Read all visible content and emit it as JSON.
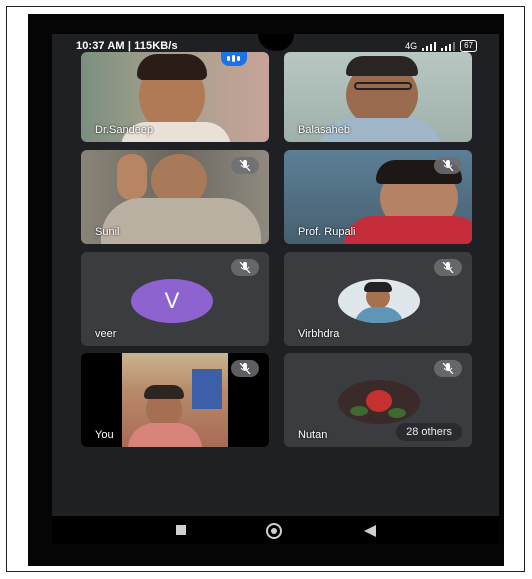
{
  "status_bar": {
    "time": "10:37 AM | 115KB/s",
    "battery": "67",
    "signal_text": "4G"
  },
  "participants": [
    {
      "name": "Dr.Sandeep",
      "muted": false,
      "speaking": true
    },
    {
      "name": "Balasaheb",
      "muted": false,
      "speaking": false
    },
    {
      "name": "Sunil",
      "muted": true,
      "speaking": false
    },
    {
      "name": "Prof. Rupali",
      "muted": true,
      "speaking": false
    },
    {
      "name": "veer",
      "muted": true,
      "avatar_letter": "V",
      "avatar_color": "#8e63cf"
    },
    {
      "name": "Virbhdra",
      "muted": true
    },
    {
      "name": "You",
      "muted": true
    },
    {
      "name": "Nutan",
      "muted": true
    }
  ],
  "others_count_label": "28 others",
  "icons": [
    "mic-off-icon",
    "speaking-indicator-icon",
    "nav-recents-icon",
    "nav-home-icon",
    "nav-back-icon"
  ],
  "colors": {
    "accent": "#1a73e8",
    "tile_bg": "#3b3c40",
    "screen_bg": "#1f2023"
  }
}
